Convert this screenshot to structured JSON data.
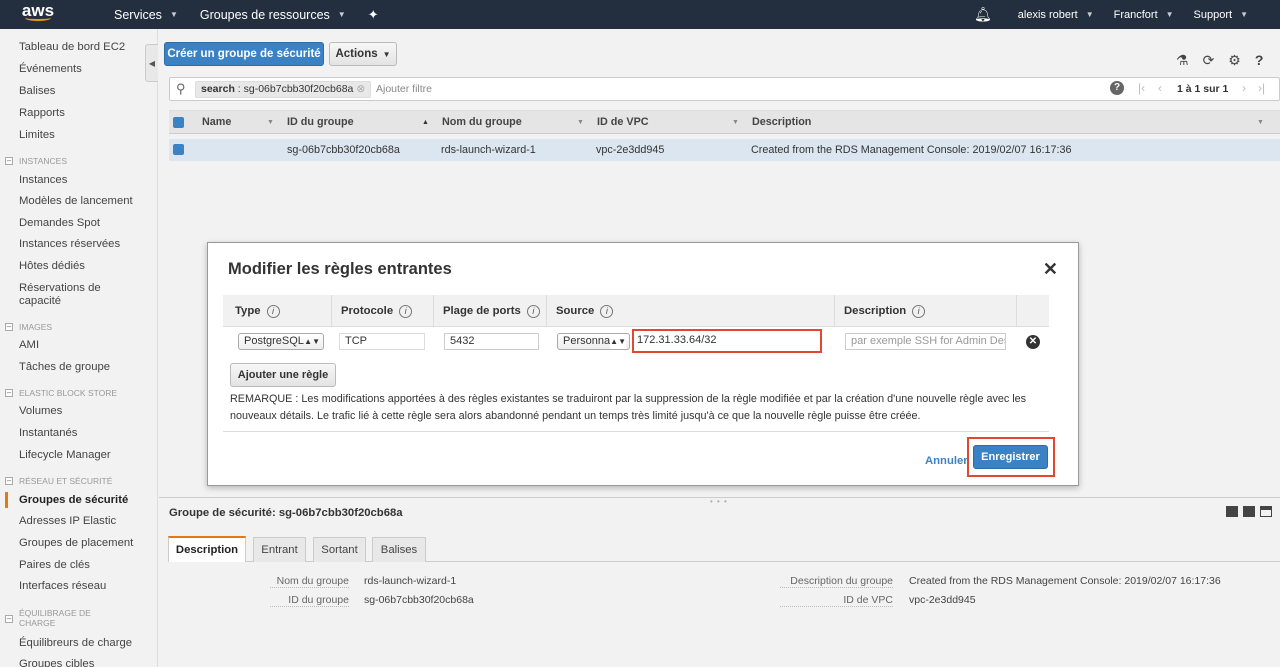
{
  "topnav": {
    "logo": "aws",
    "services": "Services",
    "resource_groups": "Groupes de ressources",
    "user": "alexis robert",
    "region": "Francfort",
    "support": "Support"
  },
  "sidebar": {
    "items": {
      "dashboard": "Tableau de bord EC2",
      "events": "Événements",
      "tags": "Balises",
      "reports": "Rapports",
      "limits": "Limites",
      "instances": "Instances",
      "launch_templates": "Modèles de lancement",
      "spot": "Demandes Spot",
      "reserved": "Instances réservées",
      "dedicated": "Hôtes dédiés",
      "capacity": "Réservations de capacité",
      "ami": "AMI",
      "bundle": "Tâches de groupe",
      "volumes": "Volumes",
      "snapshots": "Instantanés",
      "lifecycle": "Lifecycle Manager",
      "security_groups": "Groupes de sécurité",
      "elastic_ips": "Adresses IP Elastic",
      "placement": "Groupes de placement",
      "key_pairs": "Paires de clés",
      "interfaces": "Interfaces réseau",
      "load_balancers": "Équilibreurs de charge",
      "target_groups": "Groupes cibles"
    },
    "sections": {
      "instances": "INSTANCES",
      "images": "IMAGES",
      "ebs": "ELASTIC BLOCK STORE",
      "network": "RÉSEAU ET SÉCURITÉ",
      "lb": "ÉQUILIBRAGE DE CHARGE"
    }
  },
  "toolbar": {
    "create_button": "Créer un groupe de sécurité",
    "actions_button": "Actions"
  },
  "search": {
    "token_key": "search",
    "token_value": "sg-06b7cbb30f20cb68a",
    "add_filter": "Ajouter filtre",
    "pagination": "1 à 1 sur 1"
  },
  "table": {
    "headers": [
      "Name",
      "ID du groupe",
      "Nom du groupe",
      "ID de VPC",
      "Description"
    ],
    "row": {
      "name": "",
      "group_id": "sg-06b7cbb30f20cb68a",
      "group_name": "rds-launch-wizard-1",
      "vpc_id": "vpc-2e3dd945",
      "description": "Created from the RDS Management Console: 2019/02/07 16:17:36"
    }
  },
  "modal": {
    "title": "Modifier les règles entrantes",
    "columns": {
      "type": "Type",
      "protocol": "Protocole",
      "port_range": "Plage de ports",
      "source": "Source",
      "description": "Description"
    },
    "rule": {
      "type": "PostgreSQL",
      "protocol": "TCP",
      "port": "5432",
      "source_type": "Personnalisé",
      "source_cidr": "172.31.33.64/32",
      "description_placeholder": "par exemple SSH for Admin Desktop"
    },
    "add_rule": "Ajouter une règle",
    "note": "REMARQUE : Les modifications apportées à des règles existantes se traduiront par la suppression de la règle modifiée et par la création d'une nouvelle règle avec les nouveaux détails. Le trafic lié à cette règle sera alors abandonné pendant un temps très limité jusqu'à ce que la nouvelle règle puisse être créée.",
    "cancel": "Annuler",
    "save": "Enregistrer",
    "highlight_color": "#e2472f"
  },
  "details": {
    "title": "Groupe de sécurité: sg-06b7cbb30f20cb68a",
    "tabs": [
      "Description",
      "Entrant",
      "Sortant",
      "Balises"
    ],
    "fields": {
      "group_name_label": "Nom du groupe",
      "group_name_value": "rds-launch-wizard-1",
      "group_id_label": "ID du groupe",
      "group_id_value": "sg-06b7cbb30f20cb68a",
      "description_label": "Description du groupe",
      "description_value": "Created from the RDS Management Console: 2019/02/07 16:17:36",
      "vpc_label": "ID de VPC",
      "vpc_value": "vpc-2e3dd945"
    }
  }
}
